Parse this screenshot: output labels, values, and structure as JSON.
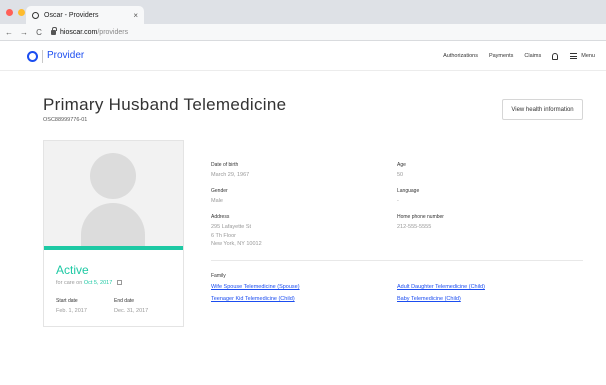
{
  "browser": {
    "tab_title": "Oscar - Providers",
    "tab_close": "×",
    "url_host": "hioscar.com",
    "url_path": "/providers",
    "nav": {
      "back": "←",
      "forward": "→",
      "reload": "C"
    },
    "colors": {
      "red": "#ff5f57",
      "yellow": "#febc2e",
      "green": "#28c840"
    }
  },
  "header": {
    "logo_text": "Provider",
    "nav": [
      "Authorizations",
      "Payments",
      "Claims"
    ],
    "menu_label": "Menu"
  },
  "member": {
    "name": "Primary Husband Telemedicine",
    "id": "OSC88999776-01",
    "view_button": "View health information",
    "status": "Active",
    "care_prefix": "for care on",
    "care_date": "Oct 5, 2017",
    "start_label": "Start date",
    "start_value": "Feb. 1, 2017",
    "end_label": "End date",
    "end_value": "Dec. 31, 2017"
  },
  "details": {
    "dob_label": "Date of birth",
    "dob_value": "March 29, 1967",
    "age_label": "Age",
    "age_value": "50",
    "gender_label": "Gender",
    "gender_value": "Male",
    "language_label": "Language",
    "language_value": "-",
    "address_label": "Address",
    "address_line1": "295 Lafayette St",
    "address_line2": "6 Th Floor",
    "address_line3": "New York, NY 10012",
    "phone_label": "Home phone number",
    "phone_value": "212-555-5555"
  },
  "family": {
    "label": "Family",
    "members": [
      "Wife Spouse Telemedicine (Spouse)",
      "Adult Daughter Telemedicine (Child)",
      "Teenager Kid Telemedicine (Child)",
      "Baby Telemedicine (Child)"
    ]
  },
  "colors": {
    "brand_blue": "#1b4df0",
    "active_green": "#1dc9a4"
  }
}
